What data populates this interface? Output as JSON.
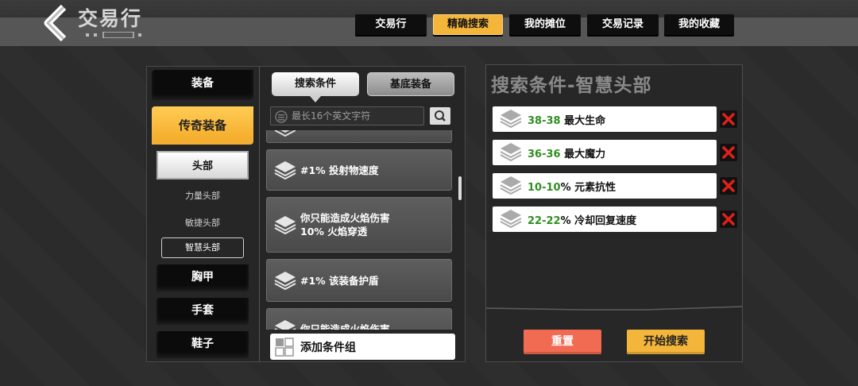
{
  "header": {
    "title": "交易行",
    "tabs": [
      {
        "label": "交易行",
        "active": false
      },
      {
        "label": "精确搜索",
        "active": true
      },
      {
        "label": "我的摊位",
        "active": false
      },
      {
        "label": "交易记录",
        "active": false
      },
      {
        "label": "我的收藏",
        "active": false
      }
    ]
  },
  "categories": {
    "equipment": "装备",
    "legendary": "传奇装备",
    "head": "头部",
    "head_subs": [
      "力量头部",
      "敏捷头部",
      "智慧头部"
    ],
    "chest": "胸甲",
    "gloves": "手套",
    "boots": "鞋子"
  },
  "middle": {
    "subtab_conditions": "搜索条件",
    "subtab_base": "基底装备",
    "search_placeholder": "最长16个英文字符",
    "options": [
      {
        "text": "#1% 投射物速度"
      },
      {
        "line1": "你只能造成火焰伤害",
        "line2": "10% 火焰穿透"
      },
      {
        "text": "#1% 该装备护盾"
      },
      {
        "line1": "你只能造成火焰伤害"
      }
    ],
    "add_group": "添加条件组"
  },
  "right": {
    "title": "搜索条件-智慧头部",
    "conditions": [
      {
        "range": "38-38",
        "label": " 最大生命"
      },
      {
        "range": "36-36",
        "label": " 最大魔力"
      },
      {
        "range": "10-10",
        "label": "% 元素抗性"
      },
      {
        "range": "22-22",
        "label": "% 冷却回复速度"
      }
    ],
    "reset": "重置",
    "start": "开始搜索"
  },
  "colors": {
    "accent": "#f4b53b",
    "reset": "#f06b52",
    "range_green": "#2f8f1f",
    "delete_red": "#e0201a"
  }
}
